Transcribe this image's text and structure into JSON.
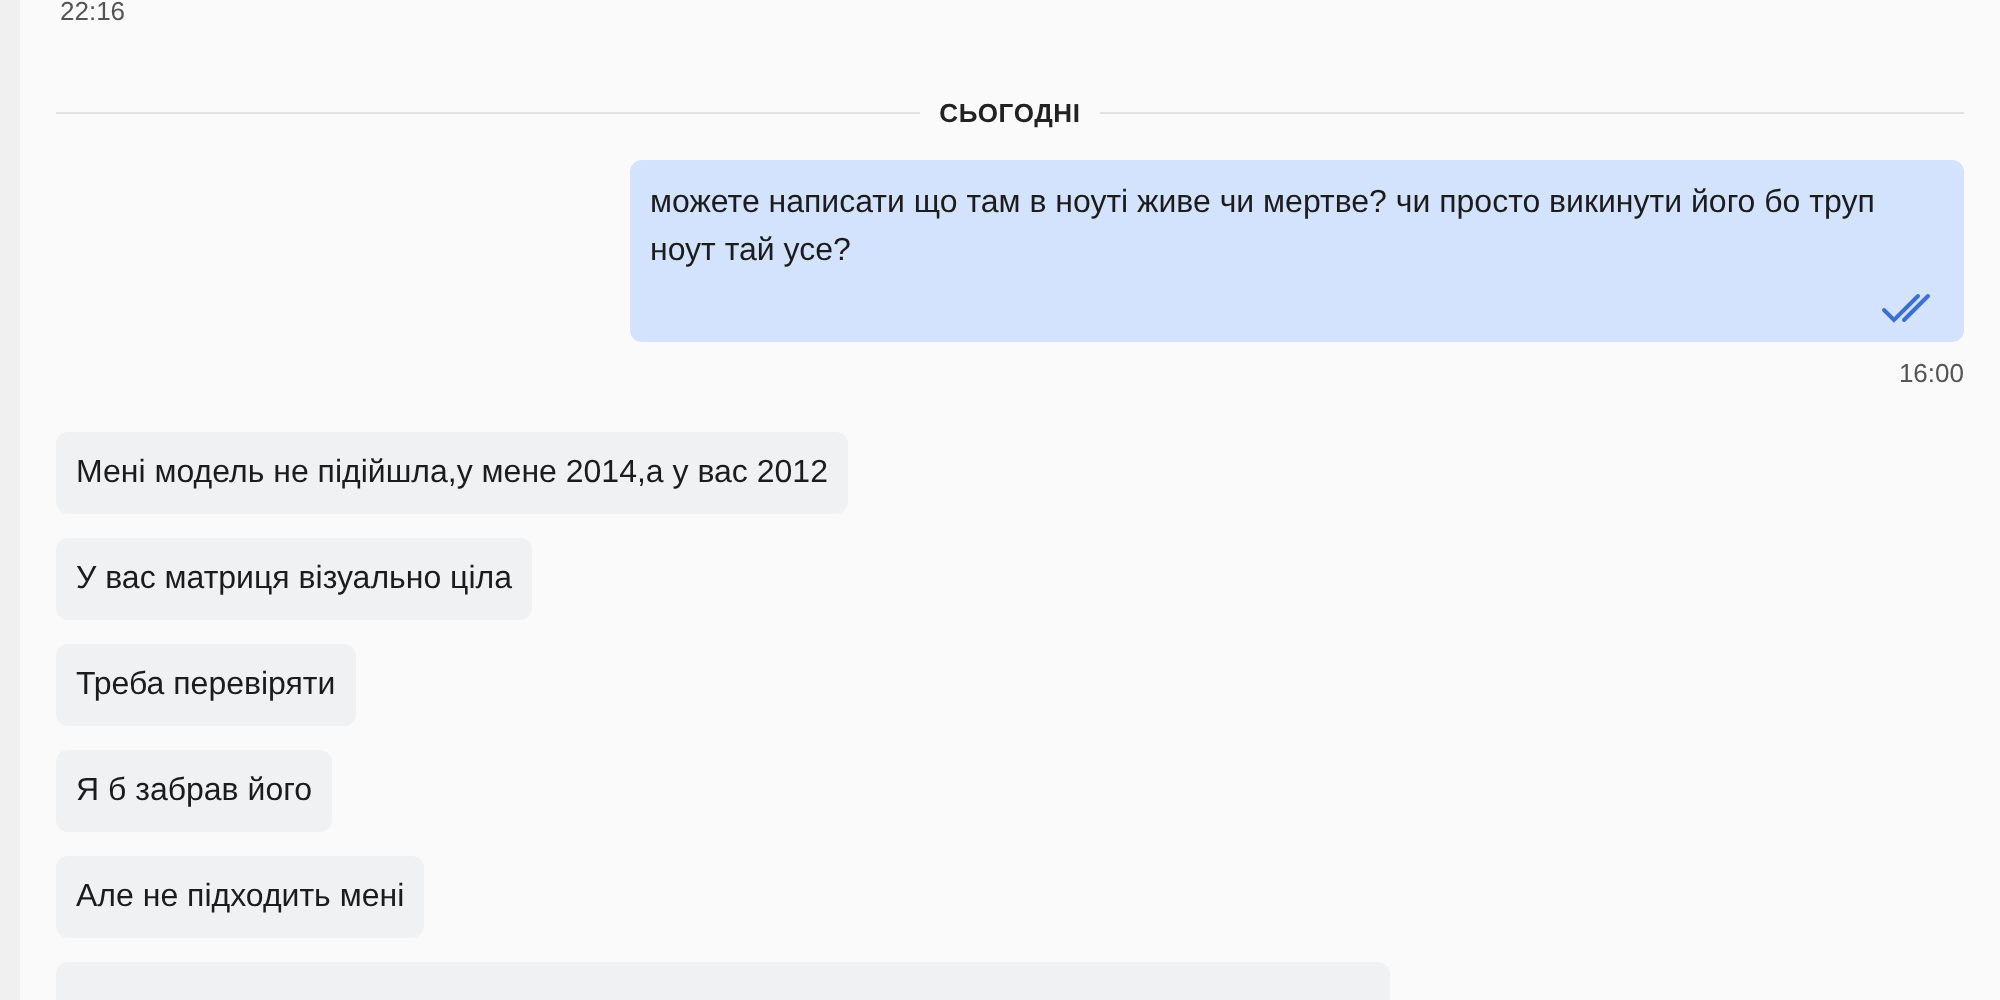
{
  "previous_time": "22:16",
  "date_divider": "СЬОГОДНІ",
  "messages": [
    {
      "kind": "outgoing",
      "text": "можете написати що там в ноуті живе чи мертве? чи просто викинути його бо труп ноут тай усе?",
      "read": true,
      "time": "16:00"
    },
    {
      "kind": "incoming",
      "text": "Мені модель не підійшла,у мене 2014,а у вас 2012"
    },
    {
      "kind": "incoming",
      "text": "У вас матриця візуально ціла"
    },
    {
      "kind": "incoming",
      "text": "Треба перевіряти"
    },
    {
      "kind": "incoming",
      "text": "Я б забрав його"
    },
    {
      "kind": "incoming",
      "text": "Але не підходить мені"
    },
    {
      "kind": "incoming_cut"
    }
  ]
}
